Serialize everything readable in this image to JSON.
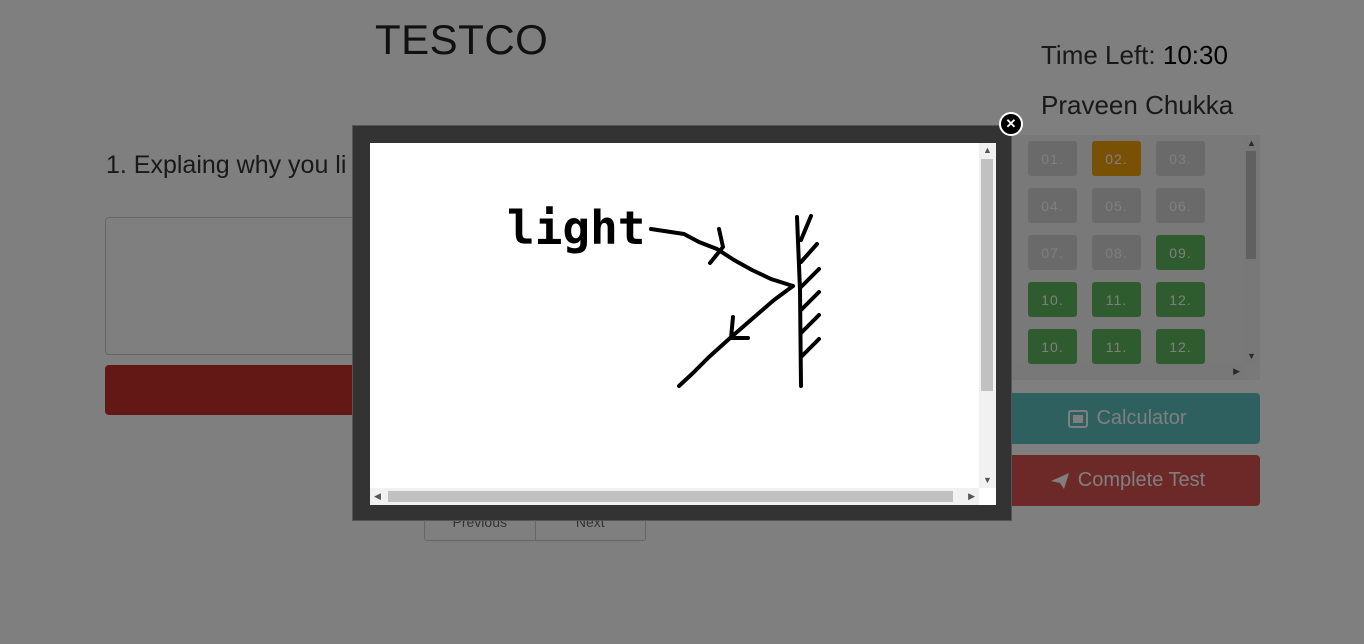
{
  "app": {
    "brand": "TESTCO"
  },
  "timer": {
    "label": "Time Left:",
    "value": "10:30"
  },
  "user": {
    "name": "Praveen Chukka"
  },
  "question": {
    "text": "1. Explaing why you li"
  },
  "questions": [
    {
      "label": "01.",
      "status": "gray"
    },
    {
      "label": "02.",
      "status": "orange"
    },
    {
      "label": "03.",
      "status": "gray"
    },
    {
      "label": "04.",
      "status": "gray"
    },
    {
      "label": "05.",
      "status": "gray"
    },
    {
      "label": "06.",
      "status": "gray"
    },
    {
      "label": "07.",
      "status": "gray"
    },
    {
      "label": "08.",
      "status": "gray"
    },
    {
      "label": "09.",
      "status": "green"
    },
    {
      "label": "10.",
      "status": "green"
    },
    {
      "label": "11.",
      "status": "green"
    },
    {
      "label": "12.",
      "status": "green"
    },
    {
      "label": "10.",
      "status": "green"
    },
    {
      "label": "11.",
      "status": "green"
    },
    {
      "label": "12.",
      "status": "green"
    }
  ],
  "status_colors": {
    "gray": "#d5d5d5",
    "orange": "#f0a30a",
    "green": "#5cb85c"
  },
  "buttons": {
    "calculator": "Calculator",
    "calculator_icon": "calculator-icon",
    "complete": "Complete Test",
    "complete_icon": "paper-plane-icon",
    "previous": "Previous",
    "next": "Next"
  },
  "modal": {
    "image_text": "light",
    "close_icon": "close-icon"
  }
}
